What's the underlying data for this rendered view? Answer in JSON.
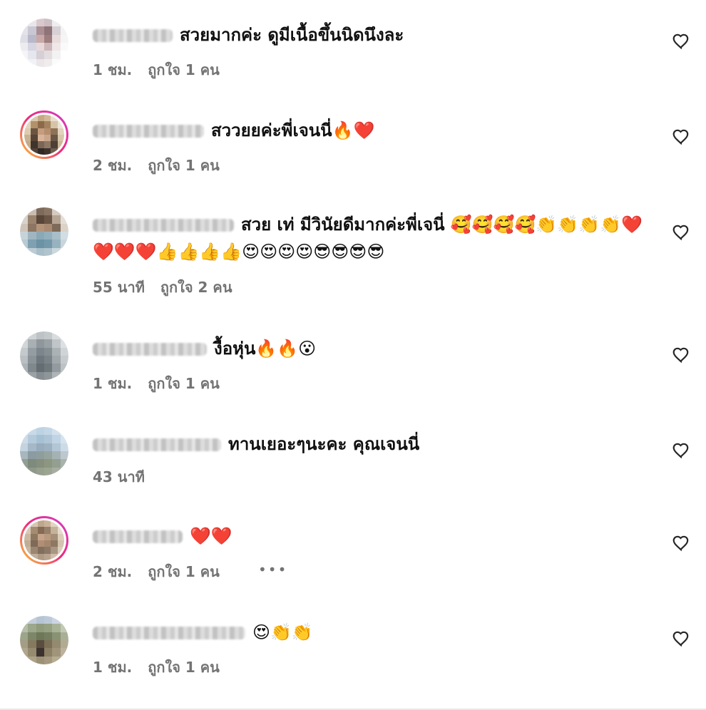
{
  "comments": [
    {
      "text": "สวยมากค่ะ ดูมีเนื้อขึ้นนิดนึงละ",
      "time": "1 ชม.",
      "likes": "ถูกใจ 1 คน",
      "has_ring": false
    },
    {
      "text": "สววยยค่ะพี่เจนนี่🔥❤️",
      "time": "2 ชม.",
      "likes": "ถูกใจ 1 คน",
      "has_ring": true
    },
    {
      "text": "สวย เท่ มีวินัยดีมากค่ะพี่เจนี่ 🥰🥰🥰🥰👏👏👏👏❤️",
      "text2": "❤️❤️❤️👍👍👍👍😍😍😍😍😎😎😎😎",
      "time": "55 นาที",
      "likes": "ถูกใจ 2 คน",
      "has_ring": false
    },
    {
      "text": "งื้อหุ่น🔥🔥😮",
      "time": "1 ชม.",
      "likes": "ถูกใจ 1 คน",
      "has_ring": false
    },
    {
      "text": "ทานเยอะๆนะคะ คุณเจนนี่",
      "time": "43 นาที",
      "likes": "",
      "has_ring": false
    },
    {
      "text": "❤️❤️",
      "time": "2 ชม.",
      "likes": "ถูกใจ 1 คน",
      "has_ring": true,
      "more": "•••"
    },
    {
      "text": "😍👏👏",
      "time": "1 ชม.",
      "likes": "ถูกใจ 1 คน",
      "has_ring": false
    }
  ],
  "icons": {
    "like": "heart-outline-icon",
    "more": "more-horizontal-icon"
  },
  "colors": {
    "text": "#111111",
    "meta": "#737373",
    "ring_start": "#f9ce34",
    "ring_end": "#d23ec9"
  }
}
